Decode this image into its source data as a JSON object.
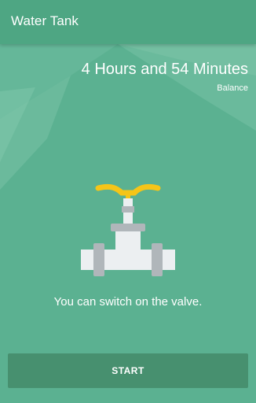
{
  "app_bar": {
    "title": "Water Tank"
  },
  "balance": {
    "value": "4 Hours and 54 Minutes",
    "label": "Balance"
  },
  "status": {
    "message": "You can switch on the valve.",
    "icon": "valve-icon"
  },
  "actions": {
    "start_label": "START"
  },
  "colors": {
    "primary": "#4ea683",
    "background": "#5bb191",
    "button": "#47906f",
    "handle": "#f5c518",
    "pipe": "#eceff1",
    "fitting": "#b0b6ba"
  }
}
